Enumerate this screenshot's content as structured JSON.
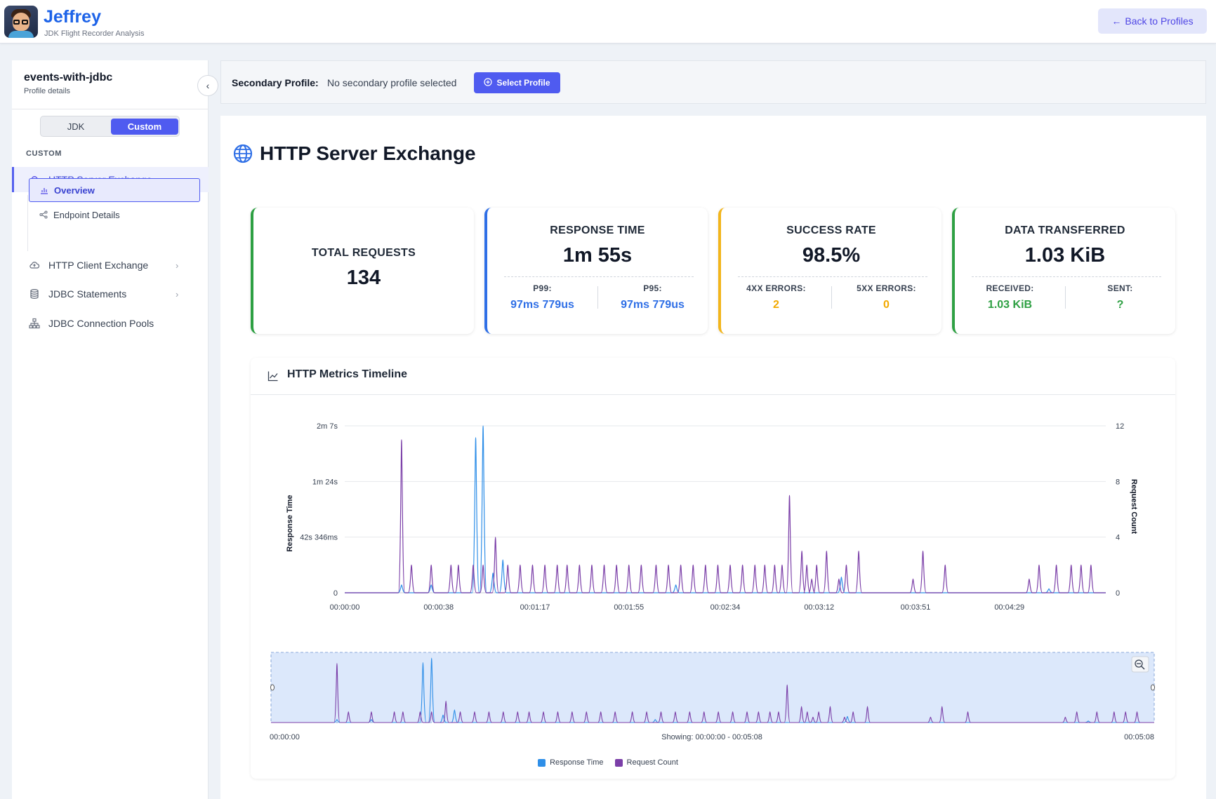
{
  "app": {
    "name": "Jeffrey",
    "subtitle": "JDK Flight Recorder Analysis",
    "back_label": "Back to Profiles"
  },
  "sidebar": {
    "profile_name": "events-with-jdbc",
    "profile_sub": "Profile details",
    "toggle": [
      "JDK",
      "Custom"
    ],
    "toggle_selected": "Custom",
    "section": "CUSTOM",
    "items": [
      {
        "label": "HTTP Server Exchange",
        "icon": "cloud-icon",
        "expanded": true
      },
      {
        "label": "HTTP Client Exchange",
        "icon": "cloud-icon"
      },
      {
        "label": "JDBC Statements",
        "icon": "database-icon"
      },
      {
        "label": "JDBC Connection Pools",
        "icon": "sitemap-icon"
      }
    ],
    "subitems": [
      {
        "label": "Overview",
        "icon": "bar-chart-icon",
        "selected": true
      },
      {
        "label": "Endpoint Details",
        "icon": "share-icon"
      }
    ]
  },
  "secondary": {
    "label": "Secondary Profile:",
    "value": "No secondary profile selected",
    "button": "Select Profile"
  },
  "page": {
    "title": "HTTP Server Exchange"
  },
  "cards": {
    "total": {
      "title": "TOTAL REQUESTS",
      "value": "134"
    },
    "response": {
      "title": "RESPONSE TIME",
      "value": "1m 55s",
      "sub1_label": "P99:",
      "sub1_value": "97ms 779us",
      "sub2_label": "P95:",
      "sub2_value": "97ms 779us"
    },
    "success": {
      "title": "SUCCESS RATE",
      "value": "98.5%",
      "sub1_label": "4XX ERRORS:",
      "sub1_value": "2",
      "sub2_label": "5XX ERRORS:",
      "sub2_value": "0"
    },
    "data": {
      "title": "DATA TRANSFERRED",
      "value": "1.03 KiB",
      "sub1_label": "RECEIVED:",
      "sub1_value": "1.03 KiB",
      "sub2_label": "SENT:",
      "sub2_value": "?"
    }
  },
  "colors": {
    "accent": "#4f5bf0",
    "response_line": "#2f8fe8",
    "count_line": "#7b3fa8",
    "green": "#2ea043",
    "blue": "#2f6fe6",
    "amber": "#f2b51c"
  },
  "timeline": {
    "title": "HTTP Metrics Timeline",
    "showing": "Showing: 00:00:00 - 00:05:08",
    "range_start": "00:00:00",
    "range_end": "00:05:08"
  },
  "chart_data": {
    "type": "line",
    "title": "",
    "xlabel": "",
    "ylabel_left": "Response Time",
    "ylabel_right": "Request Count",
    "y_left_ticks": [
      "0",
      "42s 346ms",
      "1m 24s",
      "2m 7s"
    ],
    "y_right_ticks": [
      "0",
      "4",
      "8",
      "12"
    ],
    "y_right_range": [
      0,
      12
    ],
    "y_left_range_seconds": [
      0,
      127
    ],
    "x_ticks": [
      "00:00:00",
      "00:00:38",
      "00:01:17",
      "00:01:55",
      "00:02:34",
      "00:03:12",
      "00:03:51",
      "00:04:29"
    ],
    "x_range_seconds": [
      0,
      308
    ],
    "grid": true,
    "legend_position": "bottom",
    "series": [
      {
        "name": "Response Time",
        "unit": "seconds",
        "points": [
          [
            23,
            6
          ],
          [
            35,
            6
          ],
          [
            53,
            118
          ],
          [
            56,
            127
          ],
          [
            60,
            15
          ],
          [
            64,
            25
          ],
          [
            134,
            6
          ],
          [
            201,
            12
          ],
          [
            285,
            3
          ]
        ]
      },
      {
        "name": "Request Count",
        "unit": "requests",
        "points": [
          [
            23,
            11
          ],
          [
            27,
            2
          ],
          [
            35,
            2
          ],
          [
            43,
            2
          ],
          [
            46,
            2
          ],
          [
            52,
            2
          ],
          [
            56,
            2
          ],
          [
            61,
            4
          ],
          [
            66,
            2
          ],
          [
            71,
            2
          ],
          [
            76,
            2
          ],
          [
            81,
            2
          ],
          [
            86,
            2
          ],
          [
            90,
            2
          ],
          [
            95,
            2
          ],
          [
            100,
            2
          ],
          [
            105,
            2
          ],
          [
            110,
            2
          ],
          [
            115,
            2
          ],
          [
            120,
            2
          ],
          [
            126,
            2
          ],
          [
            131,
            2
          ],
          [
            136,
            2
          ],
          [
            141,
            2
          ],
          [
            146,
            2
          ],
          [
            151,
            2
          ],
          [
            156,
            2
          ],
          [
            161,
            2
          ],
          [
            166,
            2
          ],
          [
            170,
            2
          ],
          [
            174,
            2
          ],
          [
            177,
            2
          ],
          [
            180,
            7
          ],
          [
            185,
            3
          ],
          [
            187,
            2
          ],
          [
            189,
            1
          ],
          [
            191,
            2
          ],
          [
            195,
            3
          ],
          [
            200,
            1
          ],
          [
            203,
            2
          ],
          [
            208,
            3
          ],
          [
            230,
            1
          ],
          [
            234,
            3
          ],
          [
            243,
            2
          ],
          [
            277,
            1
          ],
          [
            281,
            2
          ],
          [
            288,
            2
          ],
          [
            294,
            2
          ],
          [
            298,
            2
          ],
          [
            302,
            2
          ]
        ]
      }
    ]
  }
}
